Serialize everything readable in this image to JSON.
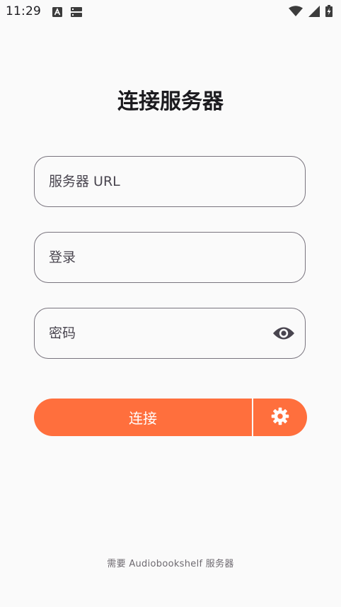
{
  "status_bar": {
    "time": "11:29",
    "left_icons": [
      "font-a-icon",
      "storage-icon"
    ],
    "right_icons": [
      "wifi-icon",
      "cellular-signal-icon",
      "battery-charging-icon"
    ]
  },
  "page": {
    "title": "连接服务器"
  },
  "form": {
    "server_url": {
      "placeholder": "服务器 URL",
      "value": ""
    },
    "login": {
      "placeholder": "登录",
      "value": ""
    },
    "password": {
      "placeholder": "密码",
      "value": "",
      "toggle_icon": "eye-icon"
    }
  },
  "actions": {
    "connect_label": "连接",
    "settings_icon": "gear-icon"
  },
  "footer": {
    "note": "需要 Audiobookshelf 服务器"
  },
  "colors": {
    "background": "#fafafa",
    "accent": "#ff6f3d",
    "outline": "#79747e",
    "text": "#1c1b1f"
  }
}
